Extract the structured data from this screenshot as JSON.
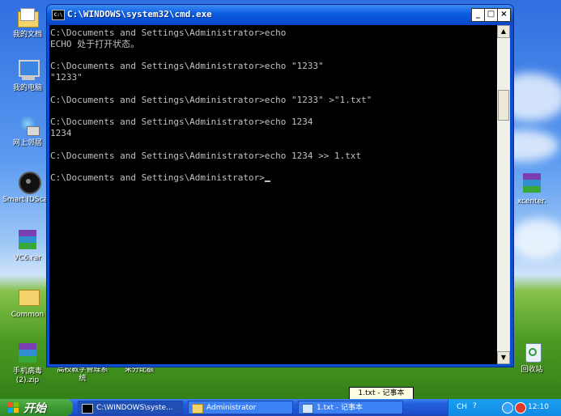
{
  "desktop": {
    "icons": [
      {
        "name": "my-documents-icon",
        "label": "我的文档"
      },
      {
        "name": "my-computer-icon",
        "label": "我的电脑"
      },
      {
        "name": "network-places-icon",
        "label": "网上邻居"
      },
      {
        "name": "smart-idscan-icon",
        "label": "Smart IDScan"
      },
      {
        "name": "vc6-rar-icon",
        "label": "VC6.rar"
      },
      {
        "name": "common-folder-icon",
        "label": "Common"
      },
      {
        "name": "phone-virus-zip-icon",
        "label": "手机病毒(2).zip"
      },
      {
        "name": "teaching-system-icon",
        "label": "高校教学管理系统"
      },
      {
        "name": "score-export-icon",
        "label": "采分配额"
      },
      {
        "name": "xcenter-icon",
        "label": "xcenter."
      },
      {
        "name": "recycle-bin-icon",
        "label": "回收站"
      }
    ]
  },
  "cmd_window": {
    "title": "C:\\WINDOWS\\system32\\cmd.exe",
    "buttons": {
      "minimize": "_",
      "maximize": "□",
      "close": "×"
    },
    "lines": [
      "C:\\Documents and Settings\\Administrator>echo",
      "ECHO 处于打开状态。",
      "",
      "C:\\Documents and Settings\\Administrator>echo \"1233\"",
      "\"1233\"",
      "",
      "C:\\Documents and Settings\\Administrator>echo \"1233\" >\"1.txt\"",
      "",
      "C:\\Documents and Settings\\Administrator>echo 1234",
      "1234",
      "",
      "C:\\Documents and Settings\\Administrator>echo 1234 >> 1.txt",
      "",
      "C:\\Documents and Settings\\Administrator>"
    ]
  },
  "tooltip": "1.txt - 记事本",
  "taskbar": {
    "start_label": "开始",
    "tasks": [
      {
        "label": "C:\\WINDOWS\\syste...",
        "icon": "cmd-icon"
      },
      {
        "label": "Administrator",
        "icon": "folder-icon"
      },
      {
        "label": "1.txt - 记事本",
        "icon": "notepad-icon"
      }
    ],
    "language": "CH",
    "clock": "12:10"
  }
}
